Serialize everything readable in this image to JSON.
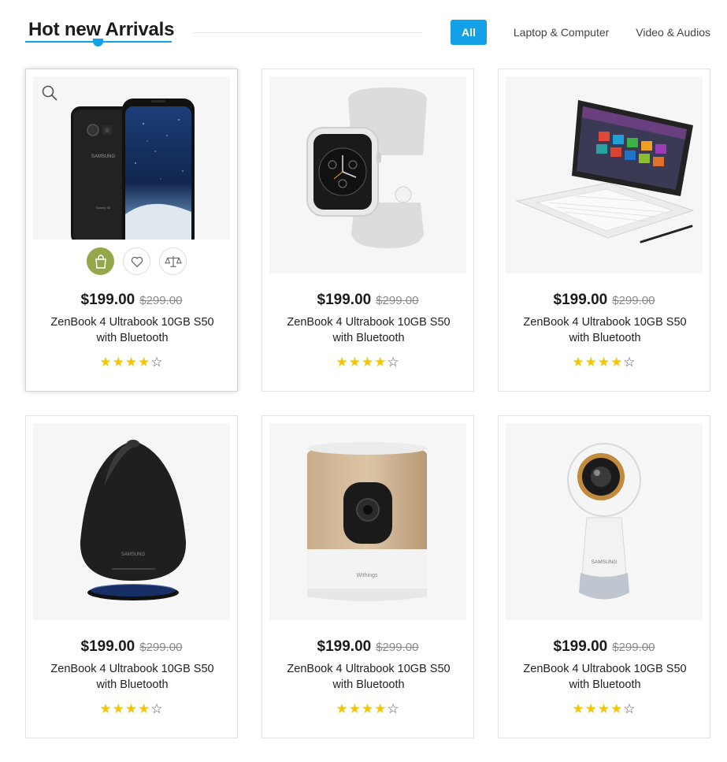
{
  "header": {
    "title": "Hot new Arrivals",
    "accent_color": "#12a1e6",
    "tabs": [
      {
        "label": "All",
        "active": true
      },
      {
        "label": "Laptop & Computer",
        "active": false
      },
      {
        "label": "Video & Audios",
        "active": false
      }
    ]
  },
  "products": [
    {
      "price": "$199.00",
      "old_price": "$299.00",
      "name_line1": "ZenBook 4 Ultrabook 10GB S50",
      "name_line2": "with Bluetooth",
      "rating": 4,
      "rating_max": 5,
      "image": "samsung-galaxy-phones",
      "brand_text": "SAMSUNG"
    },
    {
      "price": "$199.00",
      "old_price": "$299.00",
      "name_line1": "ZenBook 4 Ultrabook 10GB S50",
      "name_line2": "with Bluetooth",
      "rating": 4,
      "rating_max": 5,
      "image": "smartwatch-white"
    },
    {
      "price": "$199.00",
      "old_price": "$299.00",
      "name_line1": "ZenBook 4 Ultrabook 10GB S50",
      "name_line2": "with Bluetooth",
      "rating": 4,
      "rating_max": 5,
      "image": "tablet-with-keyboard-and-pen"
    },
    {
      "price": "$199.00",
      "old_price": "$299.00",
      "name_line1": "ZenBook 4 Ultrabook 10GB S50",
      "name_line2": "with Bluetooth",
      "rating": 4,
      "rating_max": 5,
      "image": "black-speaker",
      "brand_text": "SAMSUNG"
    },
    {
      "price": "$199.00",
      "old_price": "$299.00",
      "name_line1": "ZenBook 4 Ultrabook 10GB S50",
      "name_line2": "with Bluetooth",
      "rating": 4,
      "rating_max": 5,
      "image": "wooden-home-camera",
      "brand_text": "Withings"
    },
    {
      "price": "$199.00",
      "old_price": "$299.00",
      "name_line1": "ZenBook 4 Ultrabook 10GB S50",
      "name_line2": "with Bluetooth",
      "rating": 4,
      "rating_max": 5,
      "image": "360-camera",
      "brand_text": "SAMSUNG"
    }
  ],
  "hover_actions": {
    "icons": [
      "shopping-bag-icon",
      "heart-icon",
      "compare-scale-icon"
    ],
    "cart_color": "#93a84a"
  },
  "colors": {
    "star": "#f5c600",
    "price": "#1b1b1b",
    "old_price": "#8a8a8a"
  }
}
